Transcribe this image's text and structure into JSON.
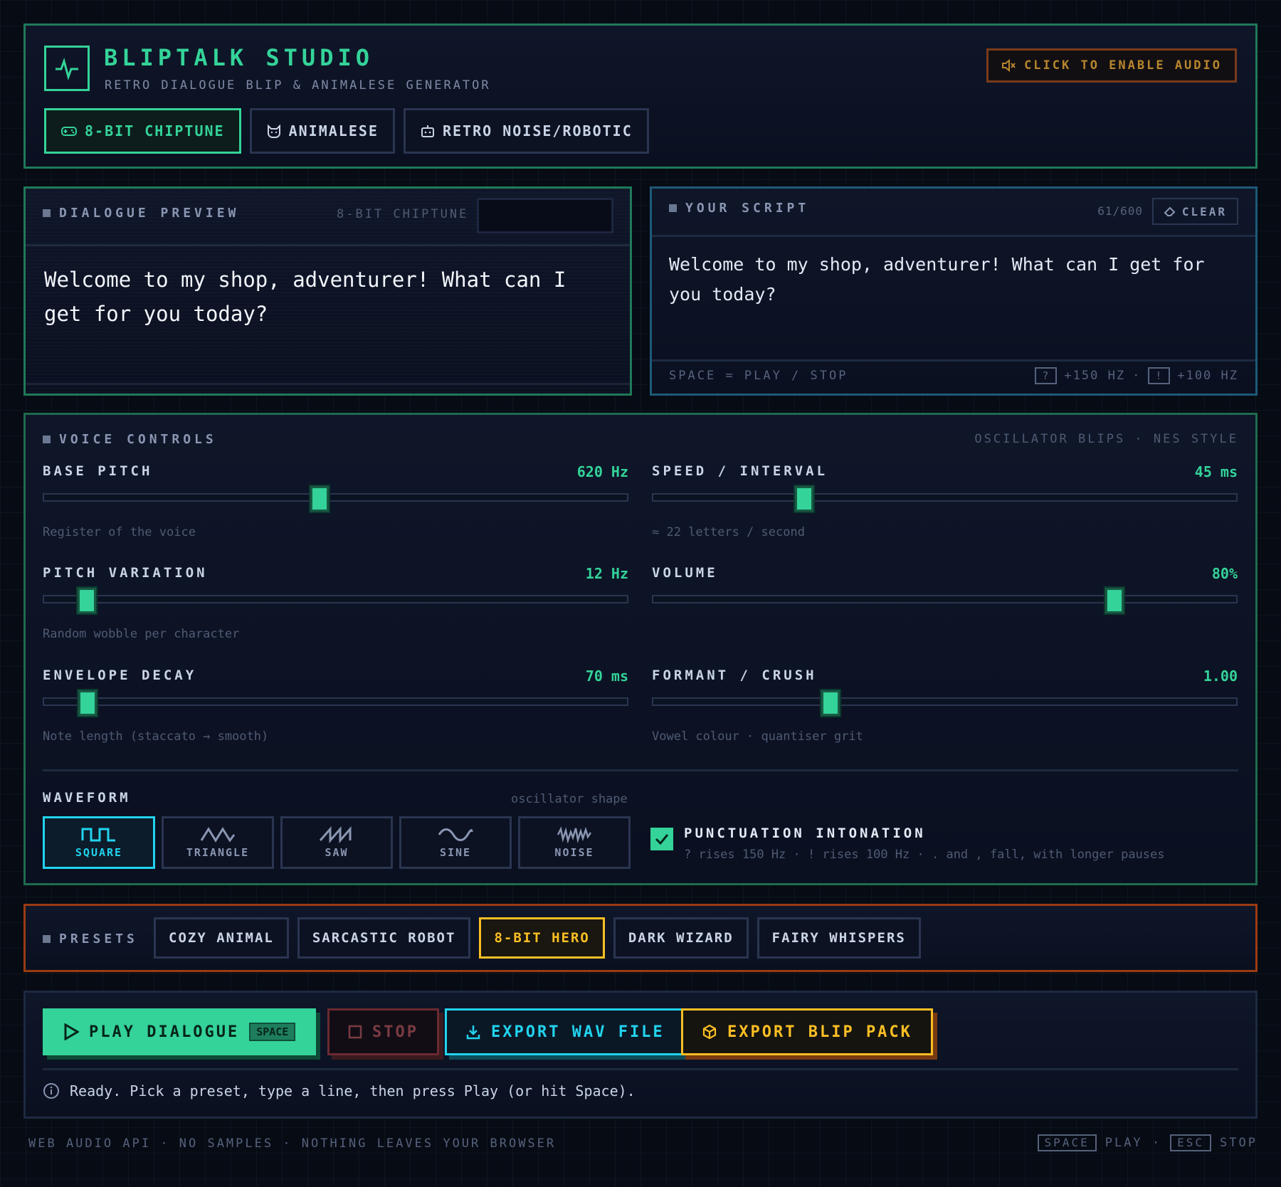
{
  "header": {
    "title": "BLIPTALK STUDIO",
    "subtitle": "RETRO DIALOGUE BLIP & ANIMALESE GENERATOR",
    "logo_icon": "pulse-icon",
    "audio_button": "CLICK TO ENABLE AUDIO",
    "modes": [
      {
        "label": "8-BIT CHIPTUNE",
        "icon": "gamepad-icon",
        "active": true
      },
      {
        "label": "ANIMALESE",
        "icon": "cat-icon",
        "active": false
      },
      {
        "label": "RETRO NOISE/ROBOTIC",
        "icon": "robot-icon",
        "active": false
      }
    ]
  },
  "preview": {
    "label": "DIALOGUE PREVIEW",
    "mode": "8-BIT CHIPTUNE",
    "text": "Welcome to my shop, adventurer! What can I get for you today?"
  },
  "script": {
    "label": "YOUR SCRIPT",
    "count": "61/600",
    "clear": "CLEAR",
    "text": "Welcome to my shop, adventurer! What can I get for you today?",
    "hint": "SPACE = PLAY / STOP",
    "q_key": "?",
    "q_value": "+150 HZ",
    "sep": "·",
    "ex_key": "!",
    "ex_value": "+100 HZ"
  },
  "controls": {
    "label": "VOICE CONTROLS",
    "meta": "OSCILLATOR BLIPS · NES STYLE",
    "sliders": [
      {
        "name": "BASE PITCH",
        "value": "620 Hz",
        "hint": "Register of the voice",
        "level": 0.473
      },
      {
        "name": "SPEED / INTERVAL",
        "value": "45 ms",
        "hint": "≈ 22 letters / second",
        "level": 0.26
      },
      {
        "name": "PITCH VARIATION",
        "value": "12 Hz",
        "hint": "Random wobble per character",
        "level": 0.075
      },
      {
        "name": "VOLUME",
        "value": "80%",
        "hint": "",
        "level": 0.79
      },
      {
        "name": "ENVELOPE DECAY",
        "value": "70 ms",
        "hint": "Note length (staccato → smooth)",
        "level": 0.077
      },
      {
        "name": "FORMANT / CRUSH",
        "value": "1.00",
        "hint": "Vowel colour · quantiser grit",
        "level": 0.305
      }
    ],
    "waveform_title": "WAVEFORM",
    "waveform_sub": "oscillator shape",
    "waveforms": [
      {
        "label": "SQUARE",
        "icon": "square-wave-icon",
        "active": true
      },
      {
        "label": "TRIANGLE",
        "icon": "triangle-wave-icon",
        "active": false
      },
      {
        "label": "SAW",
        "icon": "saw-wave-icon",
        "active": false
      },
      {
        "label": "SINE",
        "icon": "sine-wave-icon",
        "active": false
      },
      {
        "label": "NOISE",
        "icon": "noise-wave-icon",
        "active": false
      }
    ],
    "punctuation_title": "PUNCTUATION INTONATION",
    "punctuation_desc": "? rises 150 Hz · ! rises 100 Hz · . and , fall, with longer pauses",
    "punctuation_checked": true
  },
  "presets": {
    "label": "PRESETS",
    "items": [
      {
        "label": "COZY ANIMAL",
        "active": false
      },
      {
        "label": "SARCASTIC ROBOT",
        "active": false
      },
      {
        "label": "8-BIT HERO",
        "active": true
      },
      {
        "label": "DARK WIZARD",
        "active": false
      },
      {
        "label": "FAIRY WHISPERS",
        "active": false
      }
    ]
  },
  "actions": {
    "play": "PLAY DIALOGUE",
    "play_key": "SPACE",
    "stop": "STOP",
    "wav": "EXPORT WAV FILE",
    "pack": "EXPORT BLIP PACK",
    "status": "Ready. Pick a preset, type a line, then press Play (or hit Space)."
  },
  "footer": {
    "left": "WEB AUDIO API · NO SAMPLES · NOTHING LEAVES YOUR BROWSER",
    "space_key": "SPACE",
    "space_action": "PLAY ·",
    "esc_key": "ESC",
    "esc_action": "STOP"
  },
  "colors": {
    "accent": "#34d399",
    "cyan": "#22d3ee",
    "amber": "#fbbf24",
    "background": "#070b14"
  }
}
